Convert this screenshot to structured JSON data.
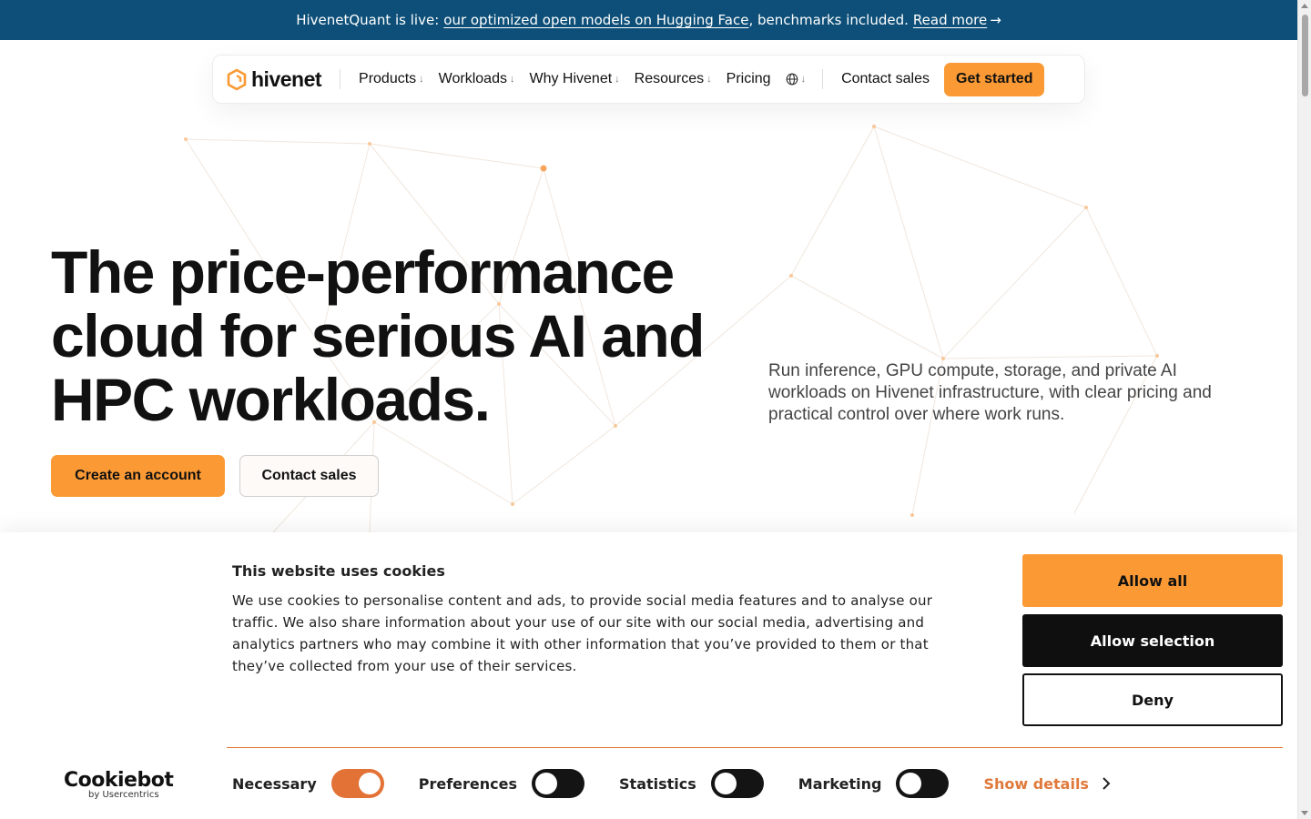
{
  "announcement": {
    "prefix": "HivenetQuant is live:",
    "link": "our optimized open models on Hugging Face",
    "suffix": ", benchmarks included.",
    "read_more": "Read more",
    "arrow": "→"
  },
  "nav": {
    "logo_text": "hivenet",
    "logo_icon": "hexagon-logo-icon",
    "items": [
      {
        "label": "Products",
        "has_dropdown": true
      },
      {
        "label": "Workloads",
        "has_dropdown": true
      },
      {
        "label": "Why Hivenet",
        "has_dropdown": true
      },
      {
        "label": "Resources",
        "has_dropdown": true
      },
      {
        "label": "Pricing",
        "has_dropdown": false
      }
    ],
    "dropdown_glyph": "↓",
    "globe_icon": "globe-icon",
    "contact_sales": "Contact sales",
    "get_started": "Get started"
  },
  "hero": {
    "title_line1": "The price-performance",
    "title_line2": "cloud for serious AI and",
    "title_line3": "HPC workloads.",
    "description": "Run inference, GPU compute, storage, and private AI workloads on Hivenet infrastructure, with clear pricing and practical control over where work runs.",
    "create_account": "Create an account",
    "contact_sales": "Contact sales"
  },
  "cookie_banner": {
    "title": "This website uses cookies",
    "text": "We use cookies to personalise content and ads, to provide social media features and to analyse our traffic. We also share information about your use of our site with our social media, advertising and analytics partners who may combine it with other information that you’ve provided to them or that they’ve collected from your use of their services.",
    "allow_all": "Allow all",
    "allow_selection": "Allow selection",
    "deny": "Deny",
    "brand": "Cookiebot",
    "brand_sub": "by Usercentrics",
    "toggles": [
      {
        "label": "Necessary",
        "on": true
      },
      {
        "label": "Preferences",
        "on": false
      },
      {
        "label": "Statistics",
        "on": false
      },
      {
        "label": "Marketing",
        "on": false
      }
    ],
    "show_details": "Show details"
  },
  "colors": {
    "accent": "#fb9a34",
    "announce_bg": "#0d4f78",
    "toggle_on": "#e27236"
  }
}
